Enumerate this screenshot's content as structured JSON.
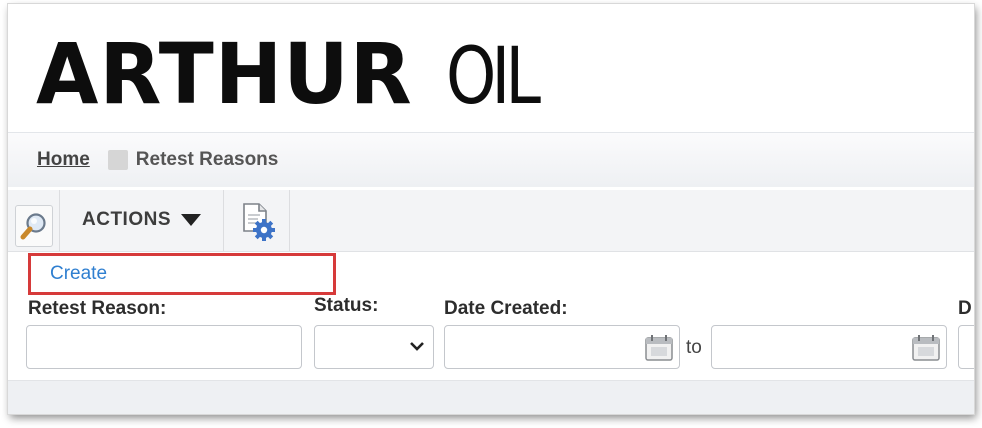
{
  "logo": {
    "main": "ARTHUR",
    "sub": "OIL"
  },
  "breadcrumb": {
    "home": "Home",
    "current": "Retest Reasons"
  },
  "toolbar": {
    "actions_label": "ACTIONS"
  },
  "menu": {
    "create_label": "Create"
  },
  "filters": {
    "retest_reason_label": "Retest Reason:",
    "retest_reason_value": "",
    "status_label": "Status:",
    "status_value": "",
    "date_created_label": "Date Created:",
    "date_from_value": "",
    "to_label": "to",
    "date_to_value": "",
    "next_label_partial": "D"
  },
  "icons": {
    "search": "magnifier-icon",
    "actions_caret": "caret-down-icon",
    "settings": "document-gear-icon",
    "calendar": "calendar-icon",
    "select": "chevron-down-icon"
  },
  "colors": {
    "create_link": "#2f7fd0",
    "highlight_border": "#d63a3a",
    "gear_blue": "#3d73c7"
  }
}
